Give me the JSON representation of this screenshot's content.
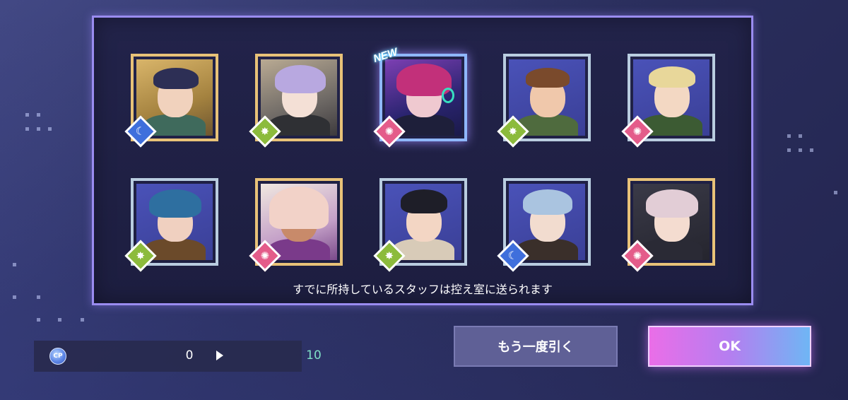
{
  "gacha_results": {
    "new_label": "NEW",
    "cards": [
      {
        "frame": "gold",
        "attribute": "moon",
        "attribute_icon": "moon-icon"
      },
      {
        "frame": "gold",
        "attribute": "star",
        "attribute_icon": "star-burst-icon"
      },
      {
        "frame": "new",
        "attribute": "sun",
        "attribute_icon": "sun-icon",
        "is_new": true
      },
      {
        "frame": "silver",
        "attribute": "star",
        "attribute_icon": "star-burst-icon"
      },
      {
        "frame": "silver",
        "attribute": "sun",
        "attribute_icon": "sun-icon"
      },
      {
        "frame": "silver",
        "attribute": "star",
        "attribute_icon": "star-burst-icon"
      },
      {
        "frame": "gold",
        "attribute": "sun",
        "attribute_icon": "sun-icon"
      },
      {
        "frame": "silver",
        "attribute": "star",
        "attribute_icon": "star-burst-icon"
      },
      {
        "frame": "silver",
        "attribute": "moon",
        "attribute_icon": "moon-icon"
      },
      {
        "frame": "gold",
        "attribute": "sun",
        "attribute_icon": "sun-icon"
      }
    ],
    "notice": "すでに所持しているスタッフは控え室に送られます"
  },
  "cp": {
    "icon_text": "CP",
    "from": "0",
    "to": "10"
  },
  "buttons": {
    "draw_again": "もう一度引く",
    "ok": "OK"
  },
  "colors": {
    "panel_border": "#9a8cf0",
    "gold_frame": "#e8c278",
    "silver_frame": "#b9cde0",
    "moon": "#3f6fdc",
    "star": "#8cbb3c",
    "sun": "#e45c8a",
    "cp_gain": "#7fe0c6"
  }
}
